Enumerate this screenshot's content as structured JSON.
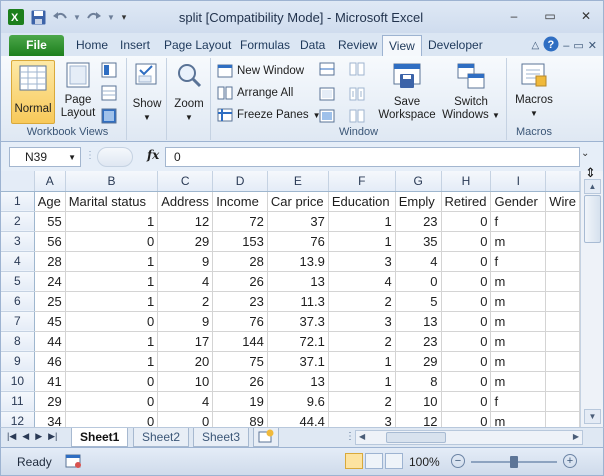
{
  "window": {
    "title": "split  [Compatibility Mode]  -  Microsoft Excel",
    "minimize": "–",
    "restore": "▭",
    "close": "✕"
  },
  "tabs": [
    {
      "label": "File"
    },
    {
      "label": "Home"
    },
    {
      "label": "Insert"
    },
    {
      "label": "Page Layout"
    },
    {
      "label": "Formulas"
    },
    {
      "label": "Data"
    },
    {
      "label": "Review"
    },
    {
      "label": "View"
    },
    {
      "label": "Developer"
    }
  ],
  "ribbon": {
    "workbook_views": {
      "label": "Workbook Views",
      "normal": "Normal",
      "page_layout_1": "Page",
      "page_layout_2": "Layout"
    },
    "show": {
      "label": "Show"
    },
    "zoom": {
      "label": "Zoom"
    },
    "window": {
      "label": "Window",
      "new_window": "New Window",
      "arrange_all": "Arrange All",
      "freeze_panes": "Freeze Panes",
      "save_workspace_1": "Save",
      "save_workspace_2": "Workspace",
      "switch_windows_1": "Switch",
      "switch_windows_2": "Windows"
    },
    "macros": {
      "label": "Macros",
      "button": "Macros"
    }
  },
  "formula_bar": {
    "name_box": "N39",
    "fx": "fx",
    "content": "0"
  },
  "grid": {
    "columns": [
      "A",
      "B",
      "C",
      "D",
      "E",
      "F",
      "G",
      "H",
      "I",
      ""
    ],
    "rows": [
      {
        "n": "1",
        "cells": [
          "Age",
          "Marital status",
          "Address",
          "Income",
          "Car price",
          "Education",
          "Emply",
          "Retired",
          "Gender",
          "Wire"
        ]
      },
      {
        "n": "2",
        "cells": [
          "55",
          "1",
          "12",
          "72",
          "37",
          "1",
          "23",
          "0",
          "f",
          ""
        ]
      },
      {
        "n": "3",
        "cells": [
          "56",
          "0",
          "29",
          "153",
          "76",
          "1",
          "35",
          "0",
          "m",
          ""
        ]
      },
      {
        "n": "4",
        "cells": [
          "28",
          "1",
          "9",
          "28",
          "13.9",
          "3",
          "4",
          "0",
          "f",
          ""
        ]
      },
      {
        "n": "5",
        "cells": [
          "24",
          "1",
          "4",
          "26",
          "13",
          "4",
          "0",
          "0",
          "m",
          ""
        ]
      },
      {
        "n": "6",
        "cells": [
          "25",
          "1",
          "2",
          "23",
          "11.3",
          "2",
          "5",
          "0",
          "m",
          ""
        ]
      },
      {
        "n": "7",
        "cells": [
          "45",
          "0",
          "9",
          "76",
          "37.3",
          "3",
          "13",
          "0",
          "m",
          ""
        ]
      },
      {
        "n": "8",
        "cells": [
          "44",
          "1",
          "17",
          "144",
          "72.1",
          "2",
          "23",
          "0",
          "m",
          ""
        ]
      },
      {
        "n": "9",
        "cells": [
          "46",
          "1",
          "20",
          "75",
          "37.1",
          "1",
          "29",
          "0",
          "m",
          ""
        ]
      },
      {
        "n": "10",
        "cells": [
          "41",
          "0",
          "10",
          "26",
          "13",
          "1",
          "8",
          "0",
          "m",
          ""
        ]
      },
      {
        "n": "11",
        "cells": [
          "29",
          "0",
          "4",
          "19",
          "9.6",
          "2",
          "10",
          "0",
          "f",
          ""
        ]
      },
      {
        "n": "12",
        "cells": [
          "34",
          "0",
          "0",
          "89",
          "44.4",
          "3",
          "12",
          "0",
          "m",
          ""
        ]
      }
    ]
  },
  "sheets": [
    {
      "label": "Sheet1",
      "active": true
    },
    {
      "label": "Sheet2",
      "active": false
    },
    {
      "label": "Sheet3",
      "active": false
    }
  ],
  "status": {
    "text": "Ready",
    "zoom": "100%",
    "zoom_minus": "−",
    "zoom_plus": "+",
    "zoom_level": 0.5
  },
  "colors": {
    "file_tab": "#1d7f1d",
    "selected_button": "#f8c95a"
  }
}
